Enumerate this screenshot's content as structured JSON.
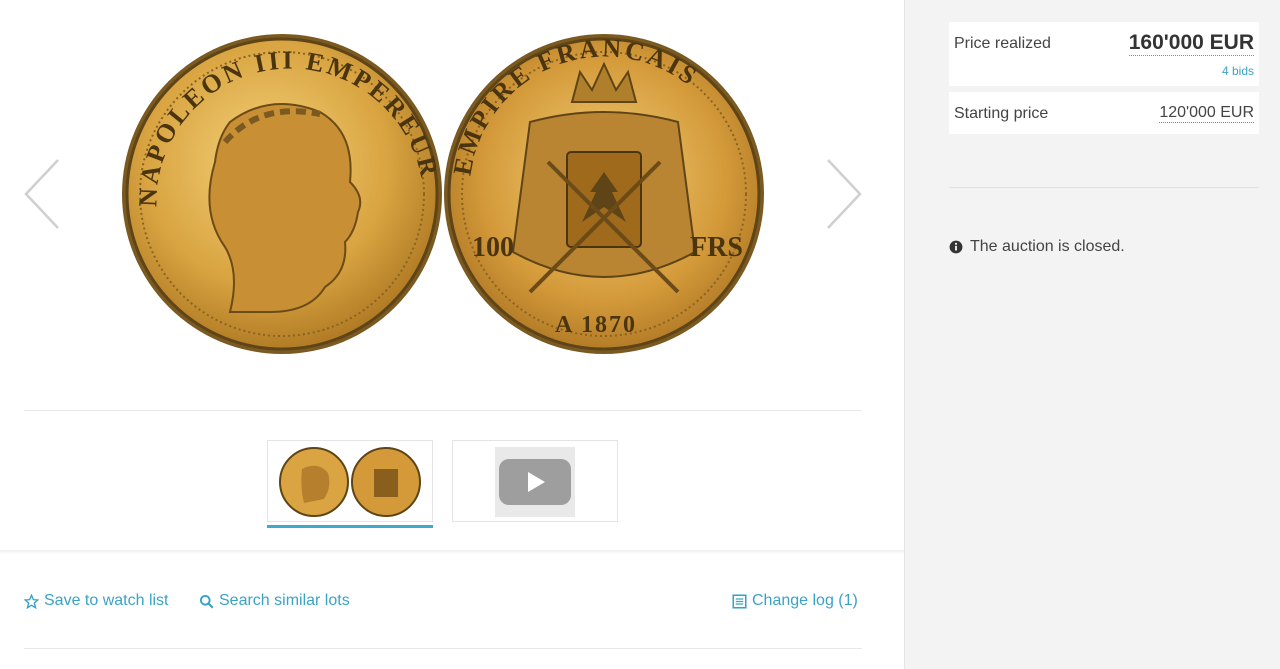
{
  "gallery": {
    "main_image_alt": "Napoleon III 100 Francs 1870 A coin obverse and reverse",
    "obverse_legend": "NAPOLEON III EMPEREUR",
    "reverse_legend": "EMPIRE FRANCAIS",
    "denomination_left": "100",
    "denomination_right": "FRS",
    "date": "A 1870",
    "thumbnails": [
      {
        "type": "image",
        "selected": true
      },
      {
        "type": "video",
        "selected": false
      }
    ]
  },
  "actions": {
    "watch": "Save to watch list",
    "search": "Search similar lots",
    "changelog": "Change log (1)"
  },
  "pricing": {
    "realized_label": "Price realized",
    "realized_value": "160'000 EUR",
    "bids": "4 bids",
    "start_label": "Starting price",
    "start_value": "120'000 EUR"
  },
  "status": {
    "text": "The auction is closed."
  },
  "colors": {
    "accent": "#3aa3c4",
    "gold": "#d9a441",
    "panel": "#f3f3f3"
  },
  "icons": [
    "chevron-left-icon",
    "chevron-right-icon",
    "star-icon",
    "search-icon",
    "list-icon",
    "info-icon",
    "play-icon"
  ]
}
